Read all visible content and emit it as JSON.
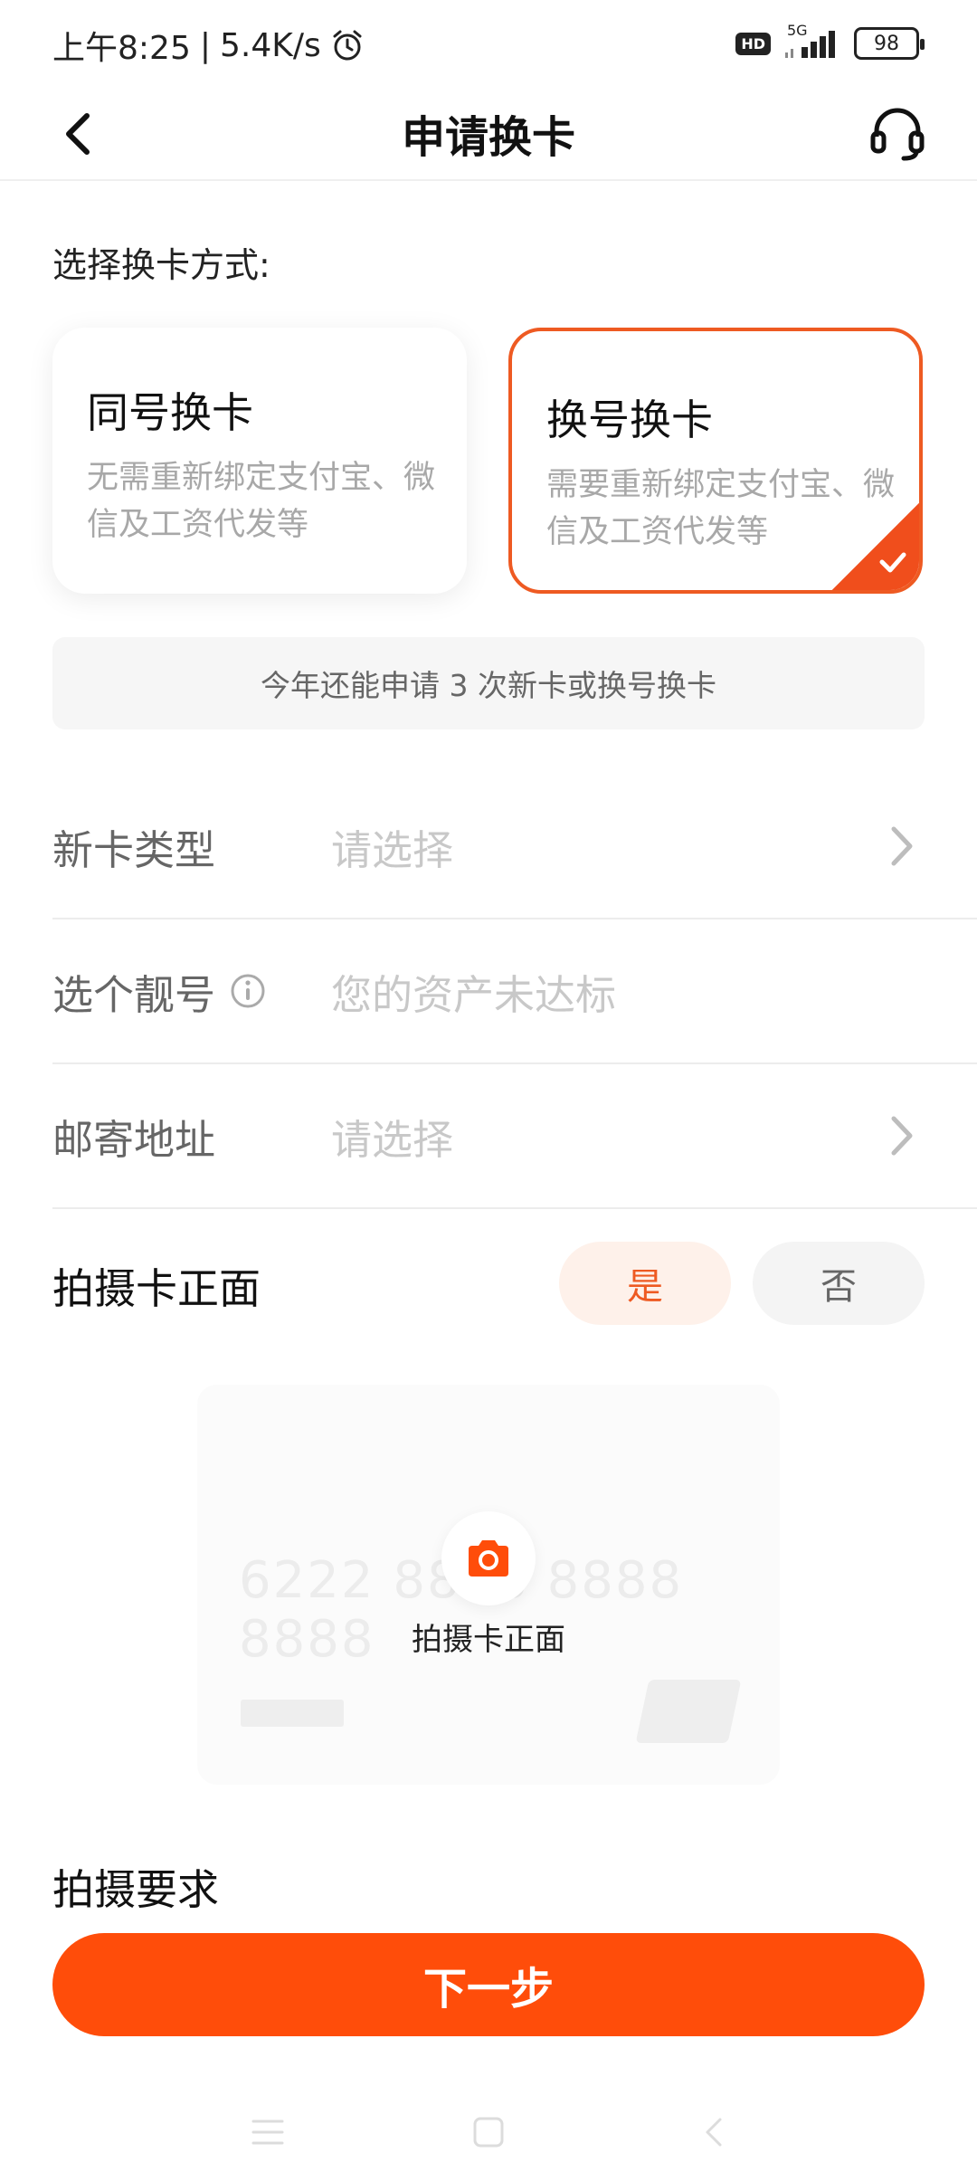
{
  "status_bar": {
    "time": "上午8:25",
    "separator": "|",
    "network_speed": "5.4K/s",
    "hd_label": "HD",
    "network_type": "5G",
    "battery_level": "98"
  },
  "nav": {
    "title": "申请换卡",
    "back_icon": "chevron-left-icon",
    "support_icon": "headset-icon"
  },
  "method": {
    "label": "选择换卡方式:",
    "options": [
      {
        "title": "同号换卡",
        "desc": "无需重新绑定支付宝、微信及工资代发等",
        "selected": false
      },
      {
        "title": "换号换卡",
        "desc": "需要重新绑定支付宝、微信及工资代发等",
        "selected": true
      }
    ]
  },
  "quota_notice": "今年还能申请 3 次新卡或换号换卡",
  "form": {
    "card_type": {
      "label": "新卡类型",
      "placeholder": "请选择"
    },
    "lucky_number": {
      "label": "选个靓号",
      "value": "您的资产未达标"
    },
    "mail_address": {
      "label": "邮寄地址",
      "placeholder": "请选择"
    }
  },
  "photo": {
    "label": "拍摄卡正面",
    "yes_label": "是",
    "no_label": "否",
    "selected": "是",
    "sample_number": "6222 8888 8888 8888",
    "capture_label": "拍摄卡正面"
  },
  "requirements_label": "拍摄要求",
  "next_button": "下一步",
  "colors": {
    "accent": "#ff4d0a",
    "selected_border": "#ee5a22",
    "placeholder": "#c8c8c8"
  }
}
